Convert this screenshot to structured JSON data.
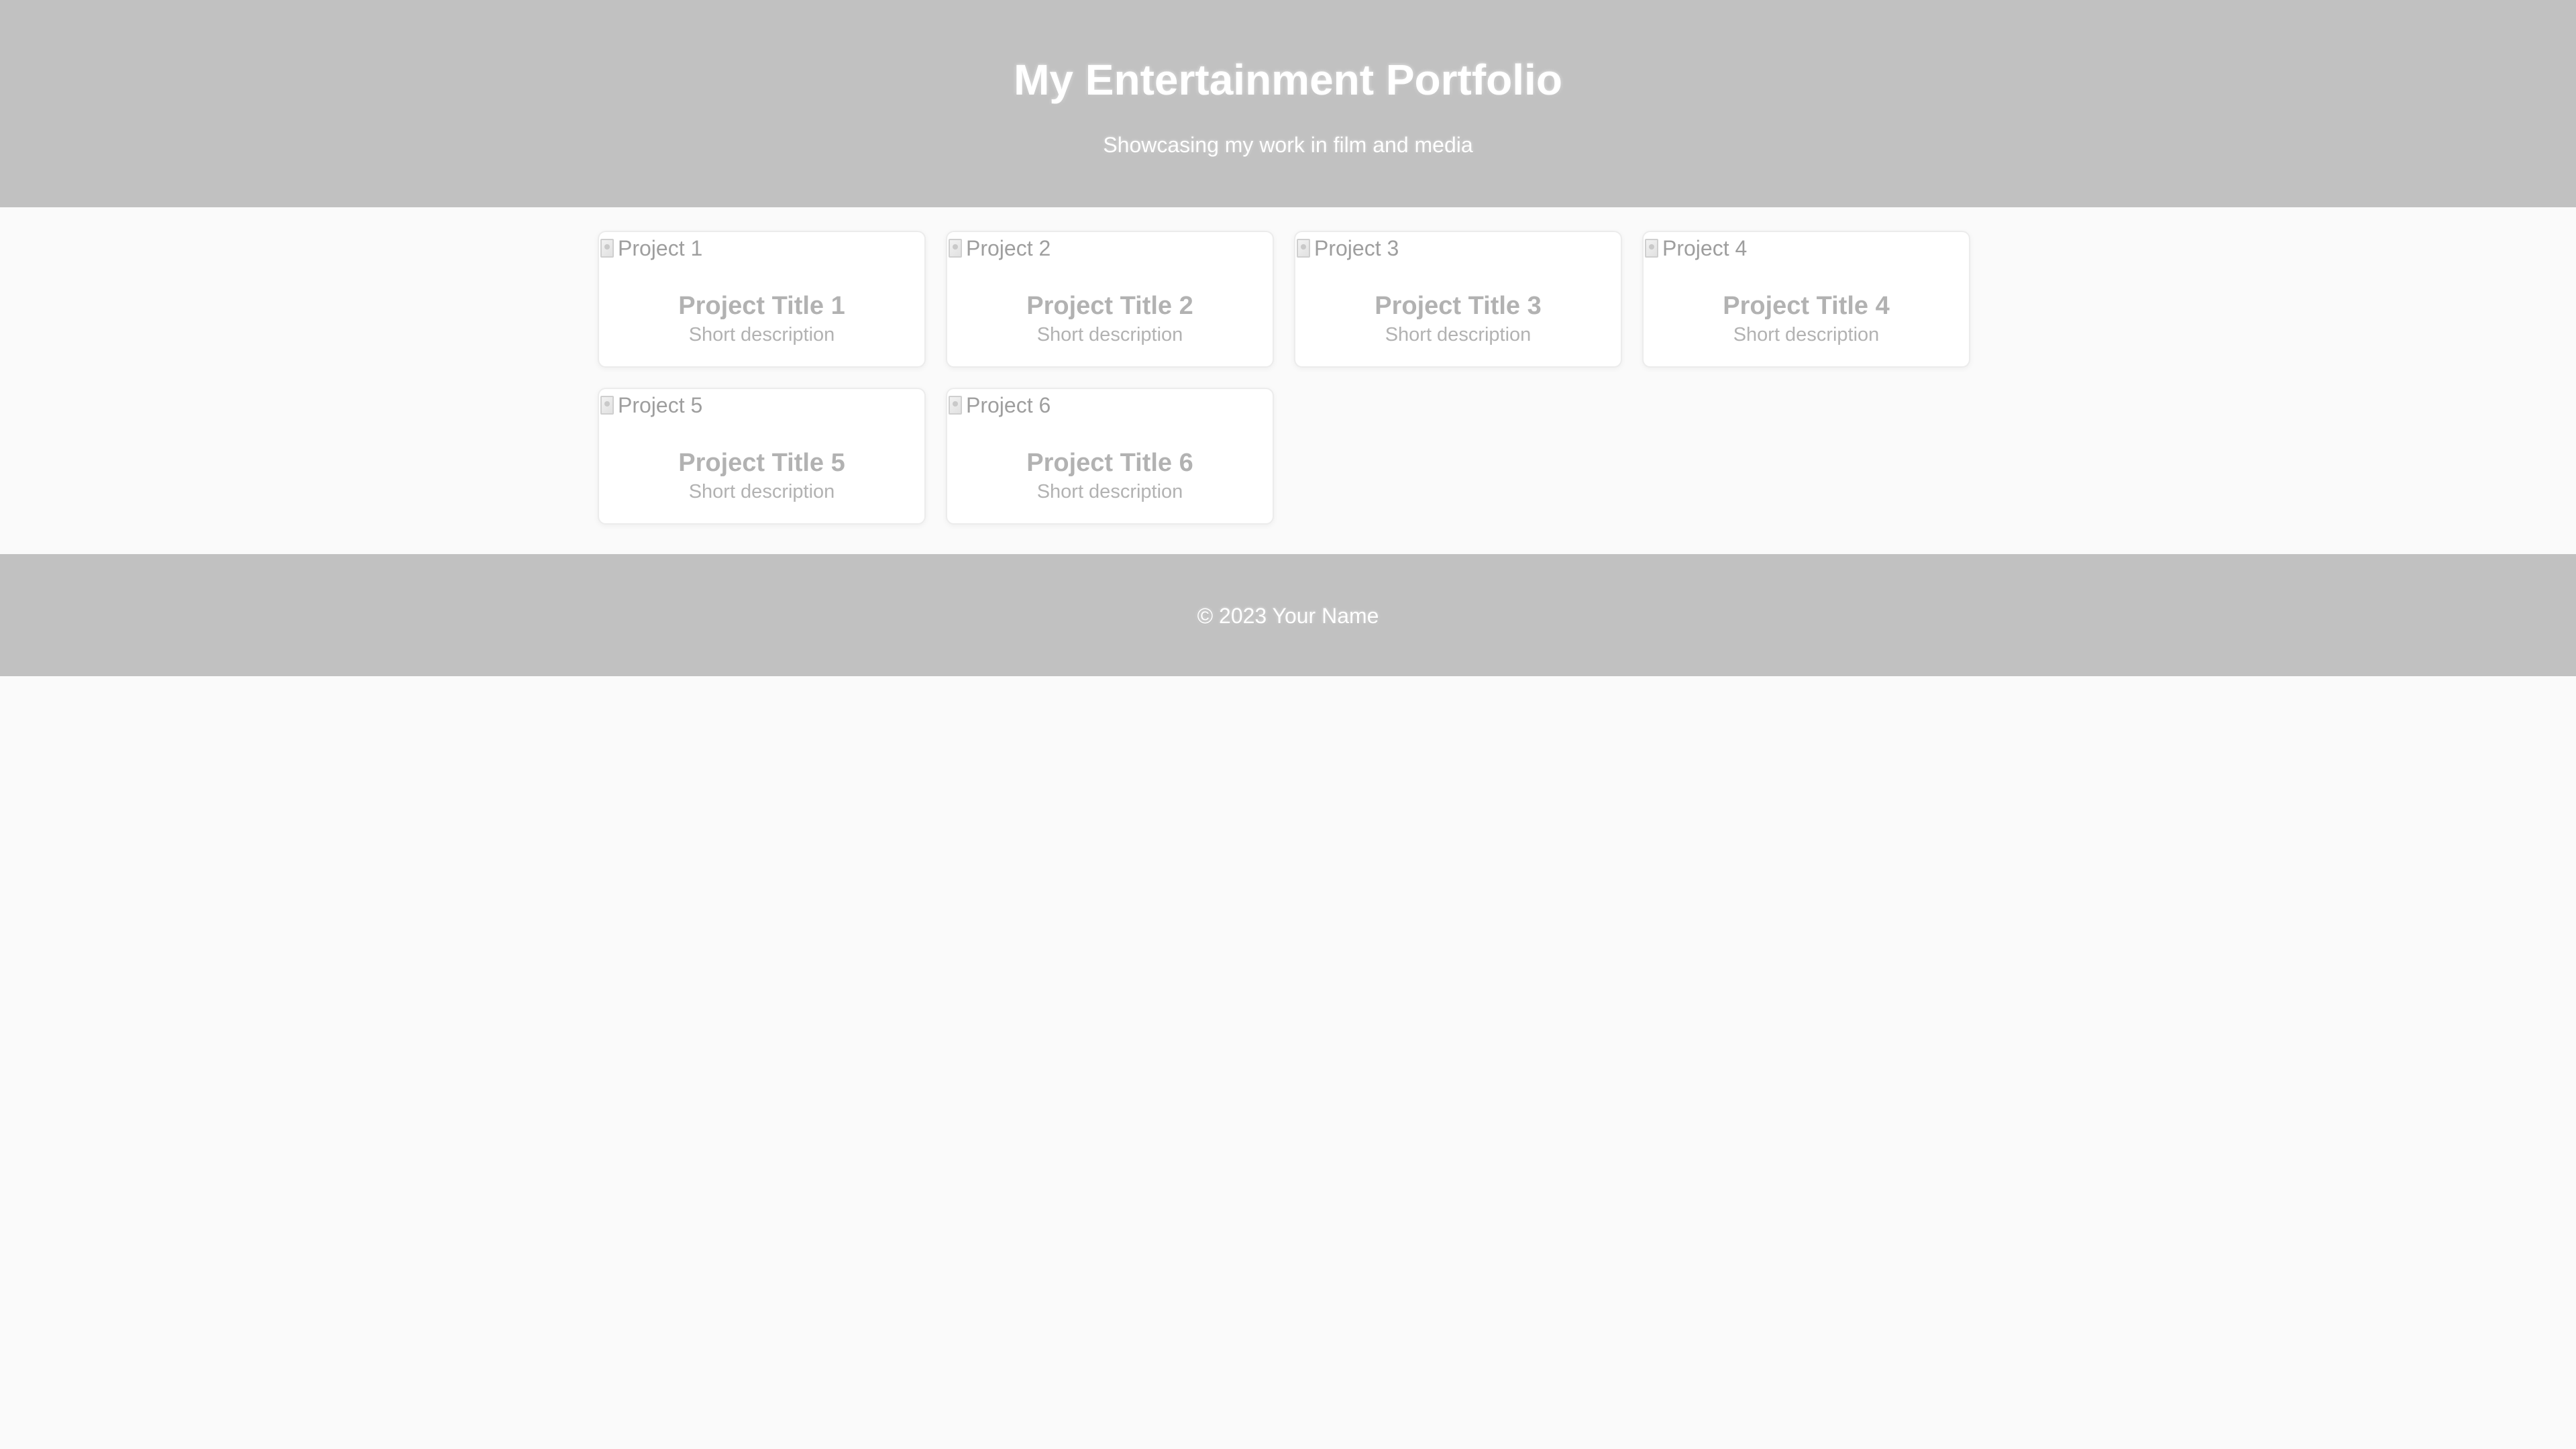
{
  "header": {
    "title": "My Entertainment Portfolio",
    "subtitle": "Showcasing my work in film and media"
  },
  "projects": [
    {
      "image_alt": "Project 1",
      "title": "Project Title 1",
      "description": "Short description"
    },
    {
      "image_alt": "Project 2",
      "title": "Project Title 2",
      "description": "Short description"
    },
    {
      "image_alt": "Project 3",
      "title": "Project Title 3",
      "description": "Short description"
    },
    {
      "image_alt": "Project 4",
      "title": "Project Title 4",
      "description": "Short description"
    },
    {
      "image_alt": "Project 5",
      "title": "Project Title 5",
      "description": "Short description"
    },
    {
      "image_alt": "Project 6",
      "title": "Project Title 6",
      "description": "Short description"
    }
  ],
  "footer": {
    "text": "© 2023 Your Name"
  },
  "colors": {
    "header_bg": "#c1c1c1",
    "page_bg": "#fafafa",
    "card_bg": "#ffffff",
    "card_text": "#b2b2b2",
    "header_text": "#ffffff"
  }
}
